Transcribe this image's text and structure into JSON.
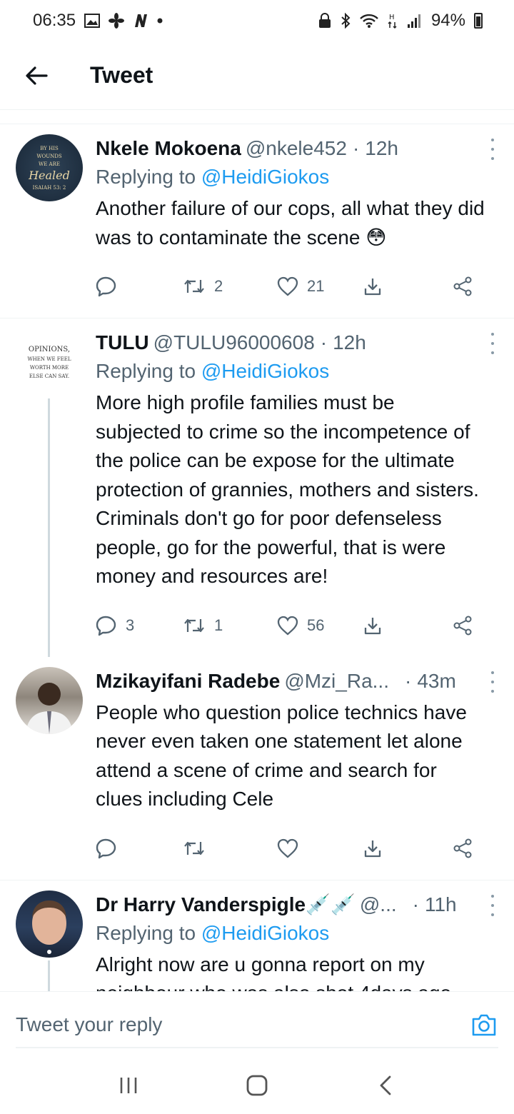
{
  "status_bar": {
    "time": "06:35",
    "battery": "94%"
  },
  "header": {
    "title": "Tweet"
  },
  "tweets": [
    {
      "name": "Nkele Mokoena",
      "handle": "@nkele452",
      "time": "12h",
      "replying_prefix": "Replying to",
      "replying_to": "@HeidiGiokos",
      "text": "Another failure of our cops, all what they did was to contaminate the scene 😳",
      "reply_count": "",
      "retweet_count": "2",
      "like_count": "21",
      "avatar": {
        "line1": "BY HIS",
        "line2": "WOUNDS",
        "line3": "WE ARE",
        "line4": "Healed",
        "line5": "ISAIAH 53: 2"
      }
    },
    {
      "name": "TULU",
      "handle": "@TULU96000608",
      "time": "12h",
      "replying_prefix": "Replying to",
      "replying_to": "@HeidiGiokos",
      "text": "More high profile families must be subjected to crime so the incompetence of the police can be expose for the ultimate protection of grannies, mothers and sisters. Criminals don't go for poor defenseless people, go for the powerful, that is were money and resources are!",
      "reply_count": "3",
      "retweet_count": "1",
      "like_count": "56",
      "avatar": {
        "line1": "OPINIONS,",
        "line2": "WHEN WE FEEL",
        "line3": "WORTH MORE",
        "line4": "ELSE CAN SAY."
      }
    },
    {
      "name": "Mzikayifani Radebe",
      "handle": "@Mzi_Ra...",
      "time": "43m",
      "text": "People who question police technics have never even taken one statement let alone attend a scene of crime and search for clues including Cele",
      "reply_count": "",
      "retweet_count": "",
      "like_count": ""
    },
    {
      "name": "Dr Harry Vanderspigle💉💉",
      "handle": "@...",
      "time": "11h",
      "replying_prefix": "Replying to",
      "replying_to": "@HeidiGiokos",
      "text": "Alright now are u gonna report on my neighbour who was also shot 4days ago and her case has not been solved  or u"
    }
  ],
  "reply_bar": {
    "placeholder": "Tweet your reply"
  },
  "icons": [
    "back-arrow-icon",
    "reply-icon",
    "retweet-icon",
    "like-icon",
    "bookmark-icon",
    "share-icon",
    "more-icon",
    "camera-icon",
    "recents-icon",
    "home-icon",
    "back-nav-icon"
  ],
  "colors": {
    "accent": "#1d9bf0",
    "secondary_text": "#536471"
  }
}
